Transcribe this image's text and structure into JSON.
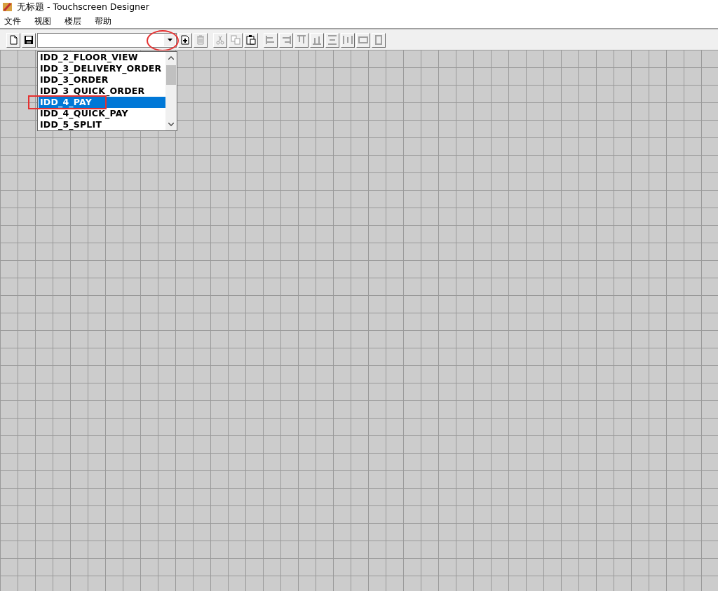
{
  "window": {
    "title": "无标题 - Touchscreen Designer"
  },
  "menu": [
    "文件",
    "视图",
    "楼层",
    "帮助"
  ],
  "toolbar": {
    "file_buttons": [
      {
        "kind": "new",
        "disabled": false
      },
      {
        "kind": "save",
        "disabled": false
      }
    ],
    "page_buttons": [
      {
        "kind": "add",
        "disabled": false
      },
      {
        "kind": "delete",
        "disabled": true
      }
    ],
    "edit_buttons": [
      {
        "kind": "cut",
        "disabled": true
      },
      {
        "kind": "copy",
        "disabled": true
      },
      {
        "kind": "paste",
        "disabled": false
      }
    ],
    "align_buttons": [
      {
        "kind": "left",
        "disabled": true
      },
      {
        "kind": "right",
        "disabled": true
      },
      {
        "kind": "top",
        "disabled": true
      },
      {
        "kind": "bottom",
        "disabled": true
      },
      {
        "kind": "vcenter",
        "disabled": true
      },
      {
        "kind": "hcenter",
        "disabled": true
      },
      {
        "kind": "samewidth",
        "disabled": true
      },
      {
        "kind": "sameheight",
        "disabled": true
      }
    ]
  },
  "dropdown": {
    "expanded": true,
    "items": [
      {
        "label": "IDD_2_FLOOR_VIEW",
        "selected": false
      },
      {
        "label": "IDD_3_DELIVERY_ORDER",
        "selected": false
      },
      {
        "label": "IDD_3_ORDER",
        "selected": false
      },
      {
        "label": "IDD_3_QUICK_ORDER",
        "selected": false
      },
      {
        "label": "IDD_4_PAY",
        "selected": true
      },
      {
        "label": "IDD_4_QUICK_PAY",
        "selected": false
      },
      {
        "label": "IDD_5_SPLIT",
        "selected": false
      }
    ]
  }
}
